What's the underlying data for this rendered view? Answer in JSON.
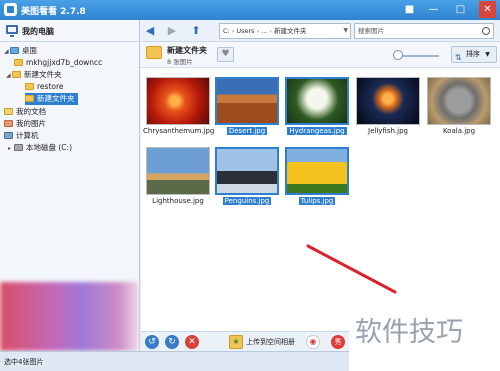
{
  "titlebar": {
    "title": "美图看看 2.7.8"
  },
  "window_controls": [
    "■",
    "—",
    "□",
    "✕"
  ],
  "left_panel": {
    "title": "我的电脑",
    "tree": [
      {
        "label": "桌面",
        "icon": "desktop-icon"
      },
      {
        "label": "mkhgjjxd7b_downcc",
        "icon": "folder-icon"
      },
      {
        "label": "新建文件夹",
        "icon": "folder-icon"
      },
      {
        "label": "restore",
        "icon": "folder-icon"
      },
      {
        "label": "新建文件夹",
        "icon": "folder-icon",
        "selected": true
      },
      {
        "label": "我的文档",
        "icon": "documents-icon"
      },
      {
        "label": "我的图片",
        "icon": "pictures-icon"
      },
      {
        "label": "计算机",
        "icon": "computer-icon"
      },
      {
        "label": "本地磁盘 (C:)",
        "icon": "drive-icon"
      }
    ]
  },
  "address_bar": {
    "segments": [
      "C:",
      "Users",
      "...",
      "新建文件夹"
    ]
  },
  "search": {
    "placeholder": "搜索图片"
  },
  "folder_header": {
    "name": "新建文件夹",
    "count": "8 张图片"
  },
  "sort_button": {
    "label": "排序"
  },
  "thumbnails": [
    {
      "filename": "Chrysanthemum.jpg",
      "selected": false
    },
    {
      "filename": "Desert.jpg",
      "selected": true
    },
    {
      "filename": "Hydrangeas.jpg",
      "selected": true
    },
    {
      "filename": "Jellyfish.jpg",
      "selected": false
    },
    {
      "filename": "Koala.jpg",
      "selected": false
    },
    {
      "filename": "Lighthouse.jpg",
      "selected": false
    },
    {
      "filename": "Penguins.jpg",
      "selected": true
    },
    {
      "filename": "Tulips.jpg",
      "selected": true
    }
  ],
  "bottom_toolbar": {
    "upload_label": "上传到空间相册"
  },
  "status_bar": {
    "text": "选中4张图片"
  },
  "watermark": {
    "text": "软件技巧"
  },
  "colors": {
    "accent": "#2f7fd1",
    "titlebar": "#3a8fdb",
    "close": "#d9443b",
    "annotation_arrow": "#d9232d"
  }
}
